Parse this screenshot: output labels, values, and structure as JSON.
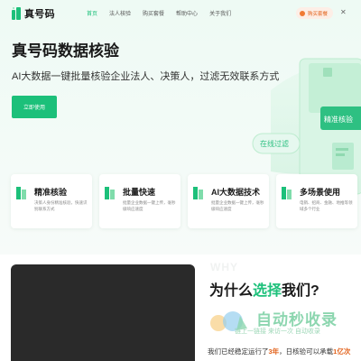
{
  "brand": {
    "name": "真号码"
  },
  "nav": {
    "items": [
      {
        "label": "首页",
        "active": true
      },
      {
        "label": "法人核验",
        "active": false
      },
      {
        "label": "购买套餐",
        "active": false
      },
      {
        "label": "帮助中心",
        "active": false
      },
      {
        "label": "关于我们",
        "active": false
      }
    ],
    "cta_label": "购买套餐",
    "close_glyph": "✕"
  },
  "hero": {
    "title": "真号码数据核验",
    "subtitle": "AI大数据一键批量核验企业法人、决策人，过滤无效联系方式",
    "button_label": "立即使用",
    "art_label_1": "精准核验",
    "art_label_2": "在线过滤"
  },
  "features": [
    {
      "title": "精准核验",
      "desc": "决策人身份精准核验，快速识别联系方式"
    },
    {
      "title": "批量快速",
      "desc": "批量企业数据一键上传，毫秒级响应速度"
    },
    {
      "title": "AI大数据技术",
      "desc": "批量企业数据一键上传，毫秒级响应速度"
    },
    {
      "title": "多场景使用",
      "desc": "电销、招商、金融、地推等领域多个行业"
    }
  ],
  "why": {
    "watermark": "WHY",
    "title_prefix": "为什么",
    "title_highlight": "选择",
    "title_suffix": "我们?"
  },
  "overlay": {
    "big": "自动秒收录",
    "small": "链上一链接 来访一次 自动收录"
  },
  "stat": {
    "prefix": "我们已经稳定运行了",
    "years": "3年",
    "middle": "，日核验可以承载",
    "volume": "1亿次"
  },
  "colors": {
    "accent": "#1cc07a",
    "orange": "#e2621b",
    "video_bg": "#2a2a2a"
  }
}
